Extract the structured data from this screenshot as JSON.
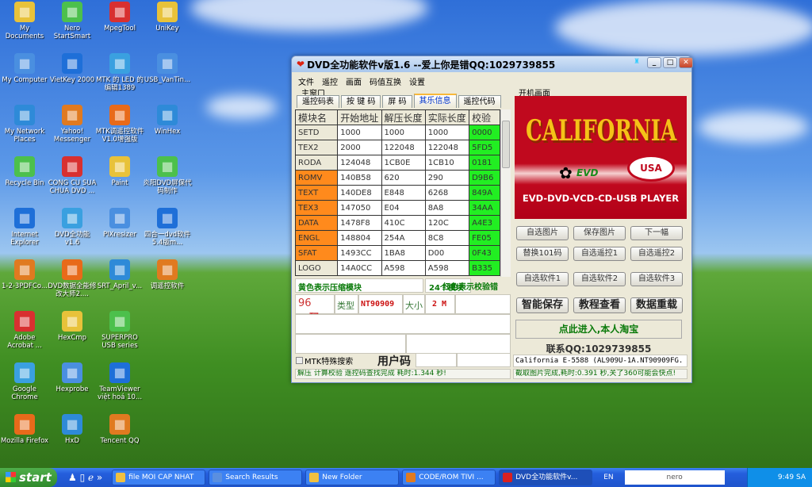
{
  "desktop": {
    "icons": [
      [
        "My Documents",
        "My Computer",
        "My Network Places",
        "Recycle Bin",
        "Internet Explorer",
        "1-2-3PDFCo...",
        "Adobe Acrobat ...",
        "Google Chrome",
        "Mozilla Firefox"
      ],
      [
        "Nero StartSmart",
        "VietKey 2000",
        "Yahoo! Messenger",
        "CONG CU SUA CHUA DVD ...",
        "DVD全功能 v1.6",
        "DVD数据全能修改大师2....",
        "HexCmp",
        "Hexprobe",
        "HxD"
      ],
      [
        "MpegTool",
        "MTK 的 LED 的 编辑1389",
        "MTK调遥控软件V1.0增强版",
        "Paint",
        "PIXresizer",
        "SRT_April_v...",
        "SUPERPRO USB series",
        "TeamViewer việt hoá 10...",
        "Tencent QQ"
      ],
      [
        "UniKey",
        "USB_VanTin...",
        "WinHex",
        "炎阳DVD屏保代码制作",
        "四合一dvd软件5.4版m...",
        "调遥控软件"
      ]
    ]
  },
  "window": {
    "title": "DVD全功能软件v版1.6 --爱上你是错QQ:1029739855",
    "menu": [
      "文件",
      "遥控",
      "画面",
      "码值互换",
      "设置"
    ],
    "main_label": "主窗口",
    "tabs": [
      "遥控码表",
      "按 键 码",
      "屏  码",
      "其乐信息",
      "遥控代码"
    ],
    "active_tab": 3,
    "table": {
      "headers": [
        "模块名",
        "开始地址",
        "解压长度",
        "实际长度",
        "校验"
      ],
      "rows": [
        {
          "name": "SETD",
          "start": "1000",
          "decomp": "1000",
          "actual": "1000",
          "check": "0000",
          "compressed": false
        },
        {
          "name": "TEX2",
          "start": "2000",
          "decomp": "122048",
          "actual": "122048",
          "check": "5FD5",
          "compressed": false
        },
        {
          "name": "RODA",
          "start": "124048",
          "decomp": "1CB0E",
          "actual": "1CB10",
          "check": "0181",
          "compressed": false
        },
        {
          "name": "ROMV",
          "start": "140B58",
          "decomp": "620",
          "actual": "290",
          "check": "D9B6",
          "compressed": true
        },
        {
          "name": "TEXT",
          "start": "140DE8",
          "decomp": "E848",
          "actual": "6268",
          "check": "849A",
          "compressed": true
        },
        {
          "name": "TEX3",
          "start": "147050",
          "decomp": "E04",
          "actual": "8A8",
          "check": "34AA",
          "compressed": true
        },
        {
          "name": "DATA",
          "start": "1478F8",
          "decomp": "410C",
          "actual": "120C",
          "check": "A4E3",
          "compressed": true
        },
        {
          "name": "ENGL",
          "start": "148804",
          "decomp": "254A",
          "actual": "8C8",
          "check": "FE05",
          "compressed": true
        },
        {
          "name": "SFAT",
          "start": "1493CC",
          "decomp": "1BA8",
          "actual": "D00",
          "check": "0F43",
          "compressed": true
        },
        {
          "name": "LOGO",
          "start": "14A0CC",
          "decomp": "A598",
          "actual": "A598",
          "check": "B335",
          "compressed": false
        }
      ]
    },
    "legend_yellow": "黄色表示压缩模块",
    "module_count": "24个模块",
    "legend_red": "红色表示校验错",
    "code_count": "96",
    "code_label": "码",
    "type_label": "类型",
    "type_value": "NT90909",
    "size_label": "大小",
    "size_value": "2 M",
    "mtk_search": "MTK特殊搜索",
    "user_code": "用户码",
    "status_left": "解压 计算校验 遥控码查找完成 耗时:1.344 秒!",
    "boot_label": "开机画面",
    "logo": {
      "brand": "CALIFORNIA",
      "sub": "EVD",
      "badge": "USA",
      "tagline": "EVD-DVD-VCD-CD-USB PLAYER"
    },
    "buttons": [
      "自选图片",
      "保存图片",
      "下一幅",
      "替换101码",
      "自选遥控1",
      "自选遥控2",
      "自选软件1",
      "自选软件2",
      "自选软件3"
    ],
    "big_buttons": [
      "智能保存",
      "教程查看",
      "数据重载"
    ],
    "taobao": "点此进入,本人淘宝",
    "contact": "联系QQ:1029739855",
    "model_line": "California E-5588 (AL909U-1A.NT90909FG.",
    "status_right": "截取图片完成,耗时:0.391 秒,关了360可能会快点!",
    "colors": {
      "compressed": "#ff8a1c",
      "check_ok": "#22ee22",
      "logo_bg": "#c0091e"
    }
  },
  "taskbar": {
    "start": "start",
    "items": [
      "file MOI CAP NHAT",
      "Search Results",
      "New Folder",
      "CODE/ROM TIVI ...",
      "DVD全功能软件v..."
    ],
    "lang": "EN",
    "search_brand": "nero",
    "time": "9:49 SA"
  }
}
